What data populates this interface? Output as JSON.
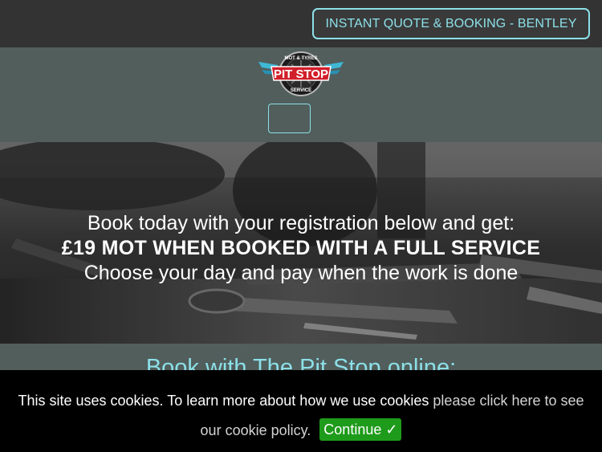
{
  "topbar": {
    "quote_button": "INSTANT QUOTE & BOOKING - BENTLEY"
  },
  "header": {
    "logo": {
      "top_text": "MOT & TYRES",
      "main_text": "PIT STOP",
      "bottom_text": "SERVICE"
    }
  },
  "hero": {
    "line1": "Book today with your registration below and get:",
    "line2": "£19 MOT WHEN BOOKED WITH A FULL SERVICE",
    "line3": "Choose your day and pay when the work is done"
  },
  "booking": {
    "heading": "Book with The Pit Stop online:"
  },
  "cookie": {
    "text": "This site uses cookies. To learn more about how we use cookies",
    "link": "please click here to see our cookie policy.",
    "continue": "Continue ✓"
  },
  "colors": {
    "accent": "#8ce0e8",
    "header_bg": "#515e5c",
    "topbar_bg": "#333333",
    "continue_bg": "#1f9b1b"
  }
}
